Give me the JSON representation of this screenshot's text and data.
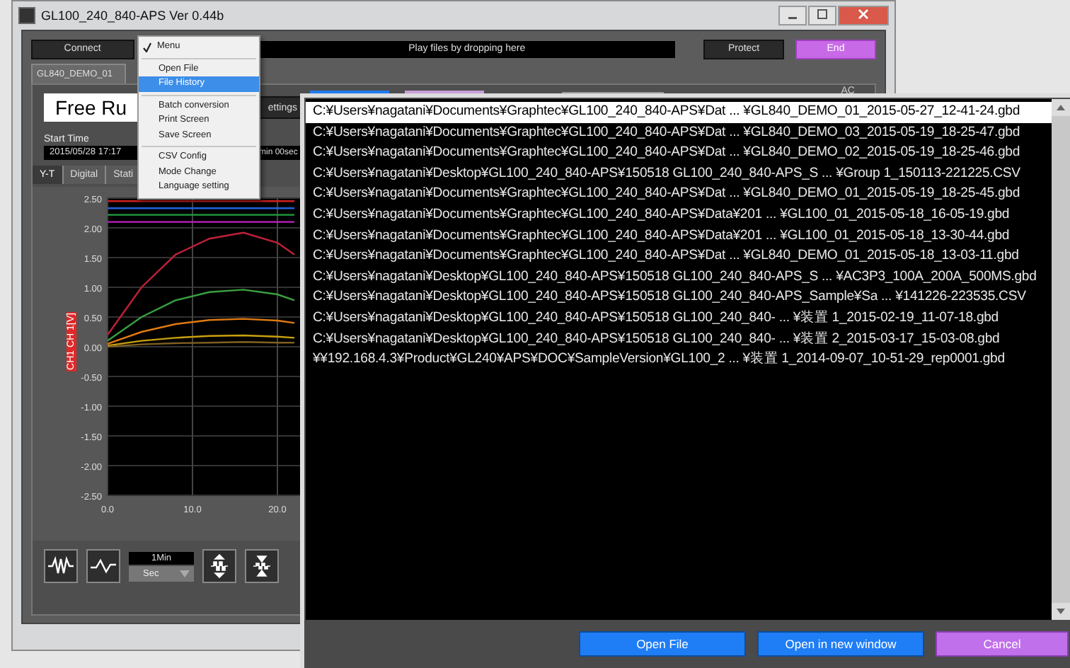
{
  "window": {
    "title": "GL100_240_840-APS Ver 0.44b"
  },
  "toolbar": {
    "connect_button": "Connect",
    "drop_field": "Play files by dropping here",
    "protect_button": "Protect",
    "end_button": "End"
  },
  "file_tab": {
    "label": "GL840_DEMO_01"
  },
  "panel": {
    "mode": "Free Ru",
    "settings_button": "ettings",
    "ac_label": "AC",
    "start_time_label": "Start Time",
    "start_time": "2015/05/28 17:17",
    "duration": "min 00sec"
  },
  "view_tabs": [
    {
      "label": "Y-T",
      "selected": true
    },
    {
      "label": "Digital",
      "selected": false
    },
    {
      "label": "Stati",
      "selected": false
    }
  ],
  "chart": {
    "y_channel_label": "CH1 CH 1[V]",
    "chart_data": {
      "type": "line",
      "grid": true,
      "x": [
        0,
        4,
        8,
        12,
        16,
        20,
        22
      ],
      "xlim": [
        0,
        23
      ],
      "ylim": [
        -2.5,
        2.5
      ],
      "xticks": [
        {
          "value": 0,
          "label": "0.0"
        },
        {
          "value": 10,
          "label": "10.0"
        },
        {
          "value": 20,
          "label": "20.0"
        }
      ],
      "yticks": [
        {
          "value": 2.5,
          "label": "2.50"
        },
        {
          "value": 2,
          "label": "2.00"
        },
        {
          "value": 1.5,
          "label": "1.50"
        },
        {
          "value": 1,
          "label": "1.00"
        },
        {
          "value": 0.5,
          "label": "0.50"
        },
        {
          "value": 0,
          "label": "0.00"
        },
        {
          "value": -0.5,
          "label": "-0.50"
        },
        {
          "value": -1,
          "label": "-1.00"
        },
        {
          "value": -1.5,
          "label": "-1.50"
        },
        {
          "value": -2,
          "label": "-2.00"
        },
        {
          "value": -2.5,
          "label": "-2.50"
        }
      ],
      "series": [
        {
          "color": "#d02020",
          "values": [
            2.45,
            2.45,
            2.45,
            2.45,
            2.45,
            2.45,
            2.45
          ]
        },
        {
          "color": "#2060e0",
          "values": [
            2.33,
            2.33,
            2.33,
            2.33,
            2.33,
            2.33,
            2.33
          ]
        },
        {
          "color": "#20a040",
          "values": [
            2.22,
            2.22,
            2.22,
            2.22,
            2.22,
            2.22,
            2.22
          ]
        },
        {
          "color": "#c020c0",
          "values": [
            2.1,
            2.1,
            2.1,
            2.1,
            2.1,
            2.1,
            2.1
          ]
        },
        {
          "color": "#c0203a",
          "values": [
            0.2,
            1.0,
            1.55,
            1.82,
            1.92,
            1.75,
            1.55
          ]
        },
        {
          "color": "#3aa040",
          "values": [
            0.1,
            0.5,
            0.78,
            0.92,
            0.96,
            0.88,
            0.78
          ]
        },
        {
          "color": "#e07a10",
          "values": [
            0.05,
            0.25,
            0.38,
            0.45,
            0.47,
            0.44,
            0.4
          ]
        },
        {
          "color": "#c8a010",
          "values": [
            0.02,
            0.1,
            0.15,
            0.18,
            0.19,
            0.17,
            0.15
          ]
        },
        {
          "color": "#806020",
          "values": [
            0,
            0.04,
            0.06,
            0.07,
            0.08,
            0.07,
            0.07
          ]
        }
      ]
    }
  },
  "bottom_toolbar": {
    "time_span": "1Min",
    "unit": "Sec"
  },
  "menu": {
    "items": [
      {
        "kind": "header",
        "label": "Menu",
        "checked": true
      },
      {
        "kind": "separator"
      },
      {
        "kind": "item",
        "label": "Open File",
        "selected": false
      },
      {
        "kind": "item",
        "label": "File History",
        "selected": true
      },
      {
        "kind": "separator"
      },
      {
        "kind": "item",
        "label": "Batch conversion",
        "selected": false
      },
      {
        "kind": "item",
        "label": "Print Screen",
        "selected": false
      },
      {
        "kind": "item",
        "label": "Save Screen",
        "selected": false
      },
      {
        "kind": "separator"
      },
      {
        "kind": "item",
        "label": "CSV Config",
        "selected": false
      },
      {
        "kind": "item",
        "label": "Mode Change",
        "selected": false
      },
      {
        "kind": "item",
        "label": "Language setting",
        "selected": false
      }
    ]
  },
  "file_history": {
    "files": [
      {
        "path": "C:¥Users¥nagatani¥Documents¥Graphtec¥GL100_240_840-APS¥Dat ... ¥GL840_DEMO_01_2015-05-27_12-41-24.gbd",
        "selected": true
      },
      {
        "path": "C:¥Users¥nagatani¥Documents¥Graphtec¥GL100_240_840-APS¥Dat ... ¥GL840_DEMO_03_2015-05-19_18-25-47.gbd",
        "selected": false
      },
      {
        "path": "C:¥Users¥nagatani¥Documents¥Graphtec¥GL100_240_840-APS¥Dat ... ¥GL840_DEMO_02_2015-05-19_18-25-46.gbd",
        "selected": false
      },
      {
        "path": "C:¥Users¥nagatani¥Desktop¥GL100_240_840-APS¥150518 GL100_240_840-APS_S ... ¥Group 1_150113-221225.CSV",
        "selected": false
      },
      {
        "path": "C:¥Users¥nagatani¥Documents¥Graphtec¥GL100_240_840-APS¥Dat ... ¥GL840_DEMO_01_2015-05-19_18-25-45.gbd",
        "selected": false
      },
      {
        "path": "C:¥Users¥nagatani¥Documents¥Graphtec¥GL100_240_840-APS¥Data¥201 ... ¥GL100_01_2015-05-18_16-05-19.gbd",
        "selected": false
      },
      {
        "path": "C:¥Users¥nagatani¥Documents¥Graphtec¥GL100_240_840-APS¥Data¥201 ... ¥GL100_01_2015-05-18_13-30-44.gbd",
        "selected": false
      },
      {
        "path": "C:¥Users¥nagatani¥Documents¥Graphtec¥GL100_240_840-APS¥Dat ... ¥GL840_DEMO_01_2015-05-18_13-03-11.gbd",
        "selected": false
      },
      {
        "path": "C:¥Users¥nagatani¥Desktop¥GL100_240_840-APS¥150518 GL100_240_840-APS_S ... ¥AC3P3_100A_200A_500MS.gbd",
        "selected": false
      },
      {
        "path": "C:¥Users¥nagatani¥Desktop¥GL100_240_840-APS¥150518 GL100_240_840-APS_Sample¥Sa ... ¥141226-223535.CSV",
        "selected": false
      },
      {
        "path": "C:¥Users¥nagatani¥Desktop¥GL100_240_840-APS¥150518 GL100_240_840- ... ¥装置 1_2015-02-19_11-07-18.gbd",
        "selected": false
      },
      {
        "path": "C:¥Users¥nagatani¥Desktop¥GL100_240_840-APS¥150518 GL100_240_840- ... ¥装置 2_2015-03-17_15-03-08.gbd",
        "selected": false
      },
      {
        "path": "¥¥192.168.4.3¥Product¥GL240¥APS¥DOC¥SampleVersion¥GL100_2 ... ¥装置 1_2014-09-07_10-51-29_rep0001.gbd",
        "selected": false
      }
    ],
    "buttons": [
      {
        "kind": "primary",
        "label": "Open File"
      },
      {
        "kind": "primary",
        "label": "Open in new window"
      },
      {
        "kind": "cancel",
        "label": "Cancel"
      }
    ]
  }
}
